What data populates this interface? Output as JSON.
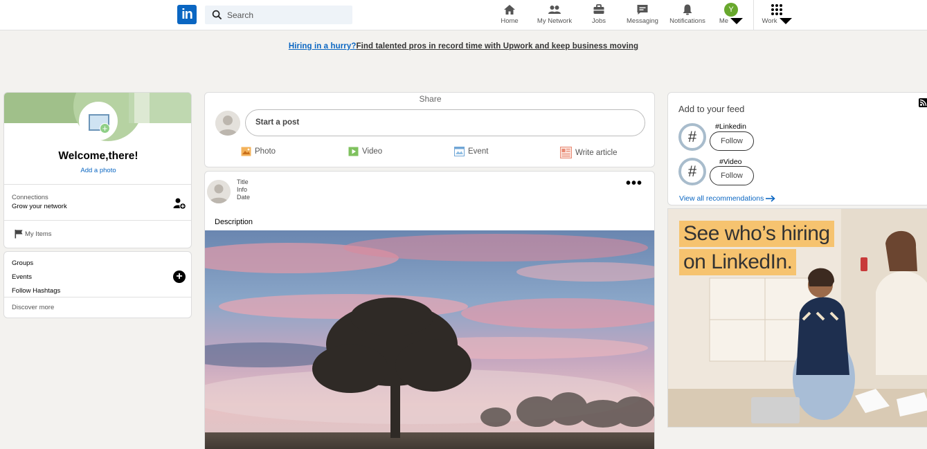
{
  "header": {
    "logo_text": "in",
    "search_placeholder": "Search",
    "nav": [
      {
        "label": "Home",
        "icon": "home-icon"
      },
      {
        "label": "My Network",
        "icon": "network-icon"
      },
      {
        "label": "Jobs",
        "icon": "jobs-icon"
      },
      {
        "label": "Messaging",
        "icon": "messaging-icon"
      },
      {
        "label": "Notifications",
        "icon": "bell-icon"
      },
      {
        "label": "Me",
        "icon": "avatar"
      },
      {
        "label": "Work",
        "icon": "grid-icon"
      }
    ],
    "me_initial": "Y"
  },
  "adline": {
    "link_text": "Hiring in a hurry?",
    "rest_text": "Find talented pros in record time with Upwork and keep business moving"
  },
  "profile": {
    "welcome": "Welcome,there!",
    "add_photo": "Add a photo",
    "connections_label": "Connections",
    "connections_sub": "Grow your network",
    "my_items": "My Items"
  },
  "groups": {
    "items": [
      "Groups",
      "Events",
      "Follow Hashtags"
    ],
    "discover": "Discover more"
  },
  "share": {
    "title": "Share",
    "start_post": "Start a post",
    "actions": [
      {
        "label": "Photo",
        "icon": "photo-icon"
      },
      {
        "label": "Video",
        "icon": "video-icon"
      },
      {
        "label": "Event",
        "icon": "event-icon"
      },
      {
        "label": "Write article",
        "icon": "article-icon"
      }
    ]
  },
  "post": {
    "title": "Title",
    "info": "Info",
    "date": "Date",
    "description": "Description"
  },
  "feed": {
    "title": "Add to your feed",
    "items": [
      {
        "name": "#Linkedin",
        "follow": "Follow"
      },
      {
        "name": "#Video",
        "follow": "Follow"
      }
    ],
    "view_all": "View all recommendations"
  },
  "ad": {
    "line1": "See who’s hiring",
    "line2": "on LinkedIn."
  },
  "colors": {
    "brand": "#0a66c2",
    "background": "#f3f2ef",
    "ad_highlight": "#f6c36f"
  }
}
